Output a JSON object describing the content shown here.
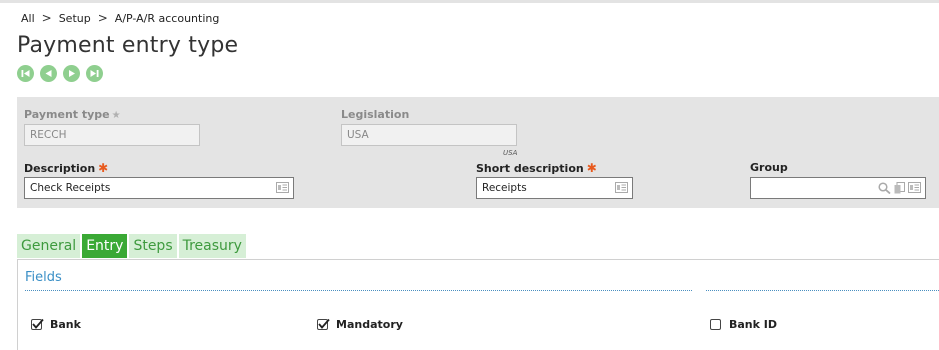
{
  "breadcrumb": [
    "All",
    "Setup",
    "A/P-A/R accounting"
  ],
  "page": {
    "title": "Payment entry type"
  },
  "record_nav": [
    "first-record-icon",
    "previous-record-icon",
    "next-record-icon",
    "last-record-icon"
  ],
  "header": {
    "payment_type": {
      "label": "Payment type",
      "value": "RECCH"
    },
    "legislation": {
      "label": "Legislation",
      "value": "USA",
      "note": "USA"
    },
    "description": {
      "label": "Description",
      "value": "Check Receipts"
    },
    "short_description": {
      "label": "Short description",
      "value": "Receipts"
    },
    "group": {
      "label": "Group",
      "value": ""
    }
  },
  "tabs": [
    {
      "label": "General",
      "active": false
    },
    {
      "label": "Entry",
      "active": true
    },
    {
      "label": "Steps",
      "active": false
    },
    {
      "label": "Treasury",
      "active": false
    }
  ],
  "section": {
    "title": "Fields"
  },
  "checkboxes": [
    {
      "label": "Bank",
      "checked": true
    },
    {
      "label": "Mandatory",
      "checked": true
    },
    {
      "label": "Bank ID",
      "checked": false
    }
  ],
  "colors": {
    "accent_green": "#3aa935",
    "tab_inactive_bg": "#d6efd6",
    "section_blue": "#3a8fc6",
    "required_star": "#e85a1e"
  }
}
